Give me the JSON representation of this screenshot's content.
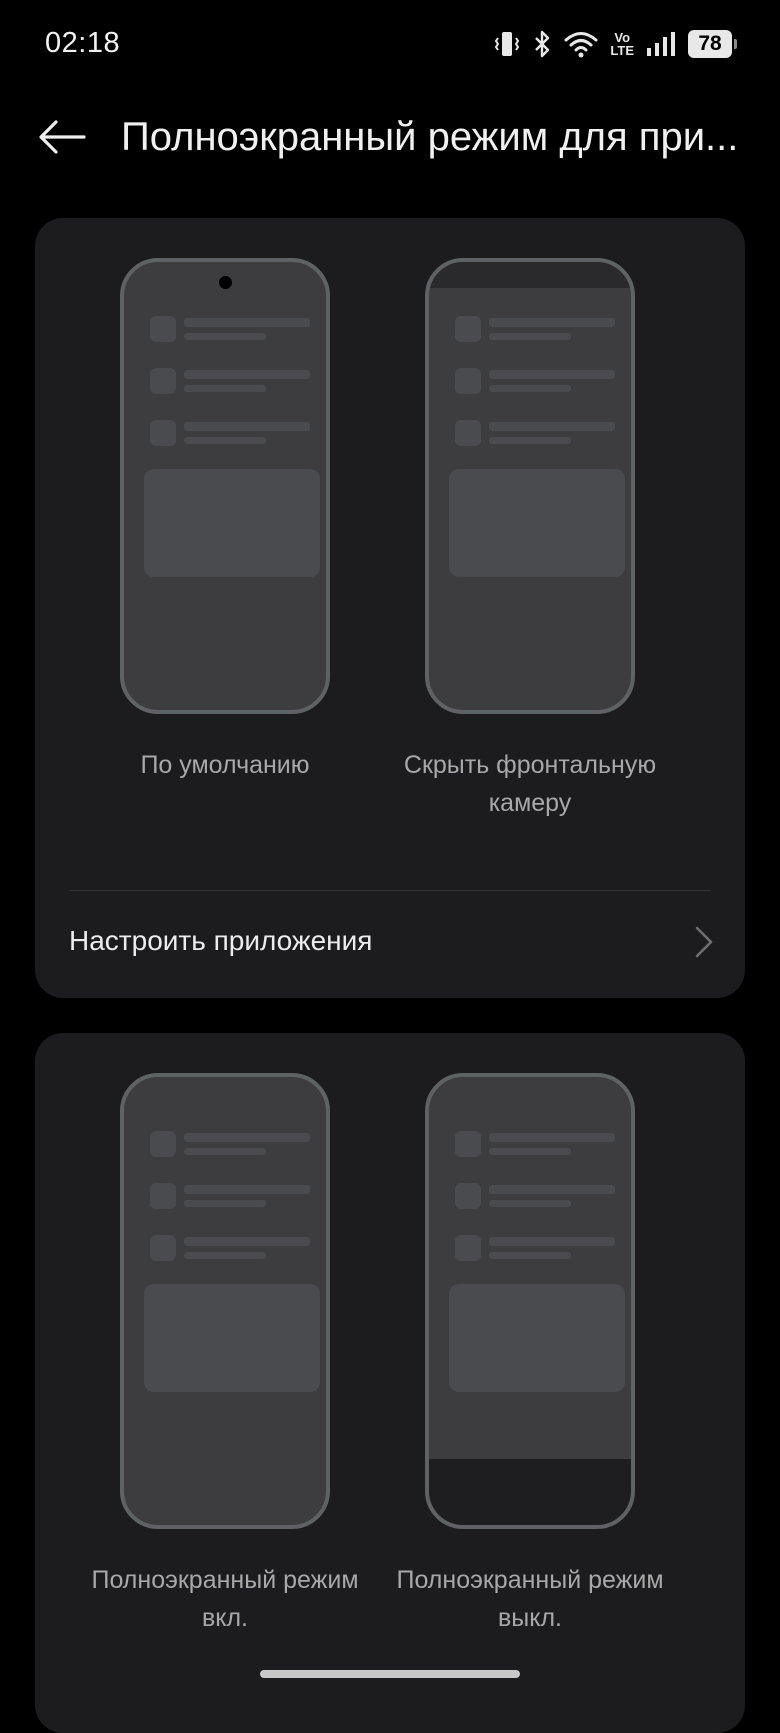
{
  "status_bar": {
    "time": "02:18",
    "volte": "Vo",
    "lte": "LTE",
    "battery": "78",
    "icons": [
      "vibrate-icon",
      "bluetooth-icon",
      "wifi-icon",
      "volte-icon",
      "signal-icon",
      "battery-icon"
    ]
  },
  "header": {
    "back_icon": "arrow-left-icon",
    "title": "Полноэкранный режим для при..."
  },
  "section_camera": {
    "options": [
      {
        "label": "По умолчанию"
      },
      {
        "label": "Скрыть фронтальную камеру"
      }
    ],
    "configure_label": "Настроить приложения",
    "configure_icon": "chevron-right-icon"
  },
  "section_fullscreen": {
    "options": [
      {
        "label": "Полноэкранный режим вкл."
      },
      {
        "label": "Полноэкранный режим выкл."
      }
    ]
  }
}
